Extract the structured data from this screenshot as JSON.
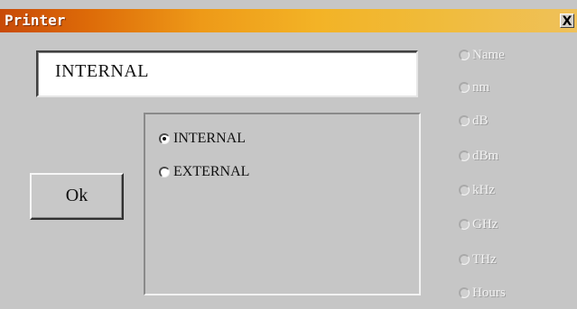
{
  "window": {
    "title": "Printer",
    "close_label": "X"
  },
  "display": {
    "value": "INTERNAL"
  },
  "ok_button": {
    "label": "Ok"
  },
  "printer_options": [
    {
      "label": "INTERNAL",
      "checked": true
    },
    {
      "label": "EXTERNAL",
      "checked": false
    }
  ],
  "unit_options": [
    {
      "label": "Name",
      "enabled": false
    },
    {
      "label": "nm",
      "enabled": false
    },
    {
      "label": "dB",
      "enabled": false
    },
    {
      "label": "dBm",
      "enabled": false
    },
    {
      "label": "kHz",
      "enabled": false
    },
    {
      "label": "GHz",
      "enabled": false
    },
    {
      "label": "THz",
      "enabled": false
    },
    {
      "label": "Hours",
      "enabled": false
    }
  ],
  "colors": {
    "titlebar_start": "#c84a08",
    "titlebar_end": "#efc15a",
    "dialog_background": "#c6c6c6"
  }
}
